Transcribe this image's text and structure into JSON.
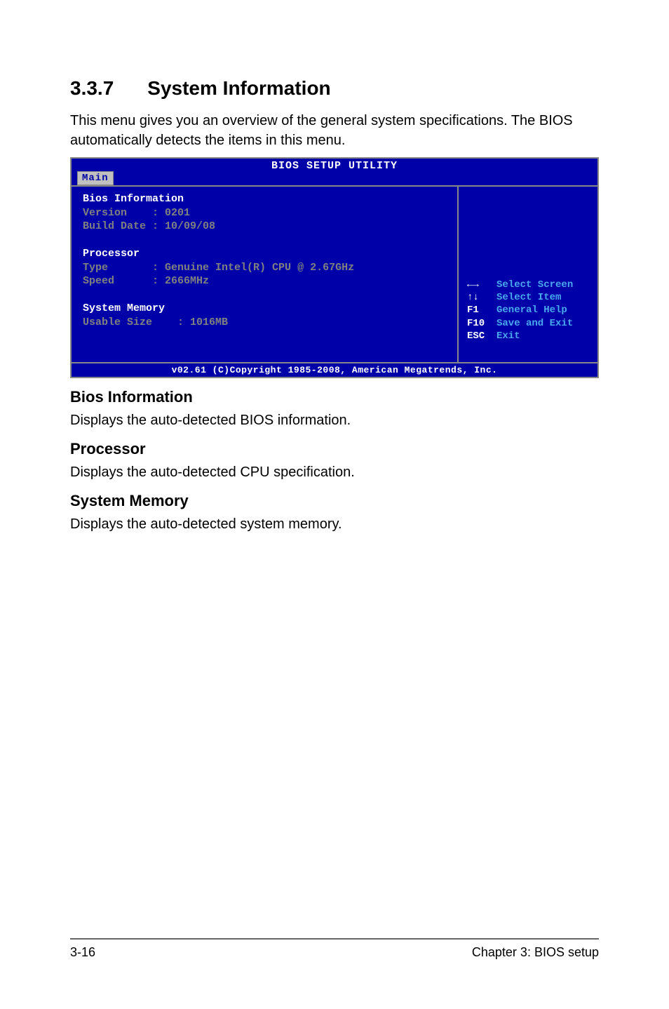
{
  "section": {
    "number": "3.3.7",
    "title": "System Information",
    "intro": "This menu gives you an overview of the general system specifications. The BIOS automatically detects the items in this menu."
  },
  "bios": {
    "title": "BIOS SETUP UTILITY",
    "tab": "Main",
    "biosInfo": {
      "heading": "Bios Information",
      "versionLabel": "Version",
      "versionValue": ": 0201",
      "buildDateLabel": "Build Date",
      "buildDateValue": ": 10/09/08"
    },
    "processor": {
      "heading": "Processor",
      "typeLabel": "Type",
      "typeValue": ": Genuine Intel(R) CPU @ 2.67GHz",
      "speedLabel": "Speed",
      "speedValue": ": 2666MHz"
    },
    "memory": {
      "heading": "System Memory",
      "usableLabel": "Usable Size",
      "usableValue": ": 1016MB"
    },
    "hints": {
      "selectScreen": "Select Screen",
      "selectItem": "Select Item",
      "f1Key": "F1",
      "f1Text": "General Help",
      "f10Key": "F10",
      "f10Text": "Save and Exit",
      "escKey": "ESC",
      "escText": "Exit"
    },
    "footer": "v02.61 (C)Copyright 1985-2008, American Megatrends, Inc."
  },
  "subsections": {
    "bios": {
      "heading": "Bios Information",
      "text": "Displays the auto-detected BIOS information."
    },
    "processor": {
      "heading": "Processor",
      "text": "Displays the auto-detected CPU specification."
    },
    "memory": {
      "heading": "System Memory",
      "text": "Displays the auto-detected system memory."
    }
  },
  "footer": {
    "pageNum": "3-16",
    "chapter": "Chapter 3: BIOS setup"
  }
}
